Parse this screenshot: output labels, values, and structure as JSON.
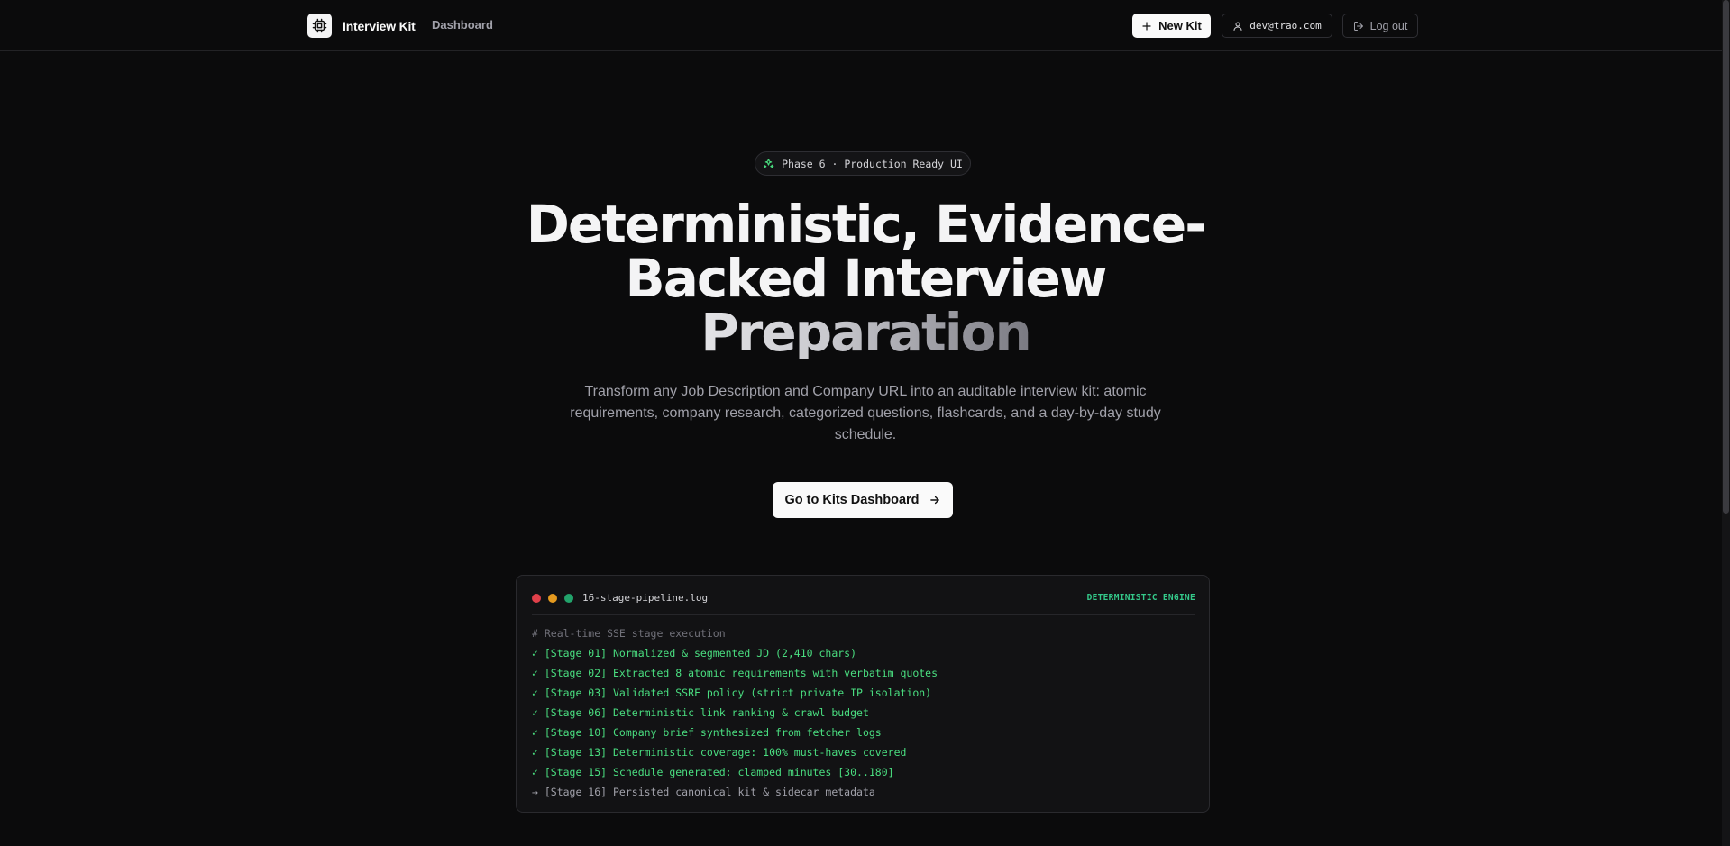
{
  "header": {
    "brand_name": "Interview Kit",
    "nav_dashboard": "Dashboard",
    "new_kit_label": "New Kit",
    "user_email": "dev@trao.com",
    "logout_label": "Log out"
  },
  "hero": {
    "badge": "Phase 6 · Production Ready UI",
    "title_line1": "Deterministic, Evidence-",
    "title_line2": "Backed Interview",
    "title_line3": "Preparation",
    "description": "Transform any Job Description and Company URL into an auditable interview kit: atomic requirements, company research, categorized questions, flashcards, and a day-by-day study schedule.",
    "cta_label": "Go to Kits Dashboard"
  },
  "terminal": {
    "filename": "16-stage-pipeline.log",
    "tag": "DETERMINISTIC ENGINE",
    "lines": [
      {
        "text": "# Real-time SSE stage execution",
        "kind": "comment"
      },
      {
        "text": "✓ [Stage 01] Normalized & segmented JD (2,410 chars)",
        "kind": "done"
      },
      {
        "text": "✓ [Stage 02] Extracted 8 atomic requirements with verbatim quotes",
        "kind": "done"
      },
      {
        "text": "✓ [Stage 03] Validated SSRF policy (strict private IP isolation)",
        "kind": "done"
      },
      {
        "text": "✓ [Stage 06] Deterministic link ranking & crawl budget",
        "kind": "done"
      },
      {
        "text": "✓ [Stage 10] Company brief synthesized from fetcher logs",
        "kind": "done"
      },
      {
        "text": "✓ [Stage 13] Deterministic coverage: 100% must-haves covered",
        "kind": "done"
      },
      {
        "text": "✓ [Stage 15] Schedule generated: clamped minutes [30..180]",
        "kind": "done"
      },
      {
        "text": "→ [Stage 16] Persisted canonical kit & sidecar metadata",
        "kind": "pending"
      }
    ]
  },
  "icons": {
    "brand": "cpu-icon",
    "new_kit": "plus-icon",
    "user": "user-icon",
    "logout": "logout-icon",
    "badge": "sparkles-icon",
    "cta": "arrow-right-icon"
  },
  "colors": {
    "background": "#0b0b0c",
    "accent_green": "#4ade80",
    "dot_red": "#e0404a",
    "dot_yellow": "#e59a1f",
    "dot_green": "#22a36b"
  }
}
